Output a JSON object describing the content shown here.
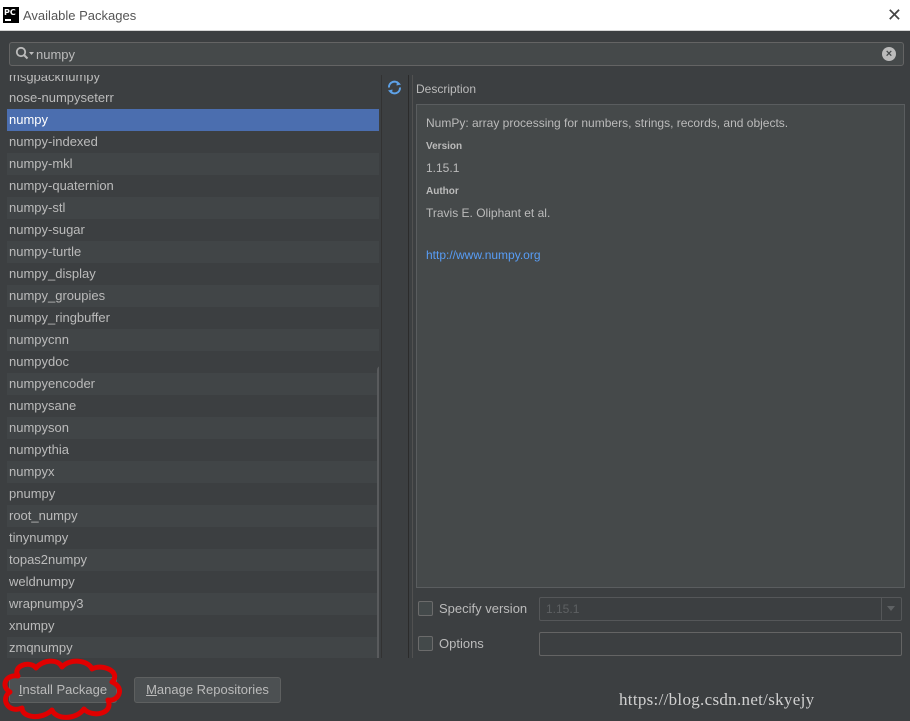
{
  "window": {
    "title": "Available Packages",
    "app_icon_text": "PC"
  },
  "search": {
    "value": "numpy"
  },
  "packages": {
    "partial_top": "msgpacknumpy",
    "items": [
      "nose-numpyseterr",
      "numpy",
      "numpy-indexed",
      "numpy-mkl",
      "numpy-quaternion",
      "numpy-stl",
      "numpy-sugar",
      "numpy-turtle",
      "numpy_display",
      "numpy_groupies",
      "numpy_ringbuffer",
      "numpycnn",
      "numpydoc",
      "numpyencoder",
      "numpysane",
      "numpyson",
      "numpythia",
      "numpyx",
      "pnumpy",
      "root_numpy",
      "tinynumpy",
      "topas2numpy",
      "weldnumpy",
      "wrapnumpy3",
      "xnumpy",
      "zmqnumpy"
    ],
    "selected": "numpy"
  },
  "description": {
    "label": "Description",
    "summary": "NumPy: array processing for numbers, strings, records, and objects.",
    "version_heading": "Version",
    "version": "1.15.1",
    "author_heading": "Author",
    "author": "Travis E. Oliphant et al.",
    "url": "http://www.numpy.org"
  },
  "options": {
    "specify_version_label": "Specify version",
    "specify_version_checked": false,
    "version_value": "1.15.1",
    "options_label": "Options",
    "options_checked": false,
    "options_value": ""
  },
  "buttons": {
    "install_prefix": "I",
    "install_rest": "nstall Package",
    "manage_prefix": "M",
    "manage_rest": "anage Repositories"
  },
  "watermark": "https://blog.csdn.net/skyejy",
  "colors": {
    "background": "#3c3f41",
    "selection": "#4b6eaf",
    "link": "#589df6",
    "annotation": "#e00000"
  }
}
